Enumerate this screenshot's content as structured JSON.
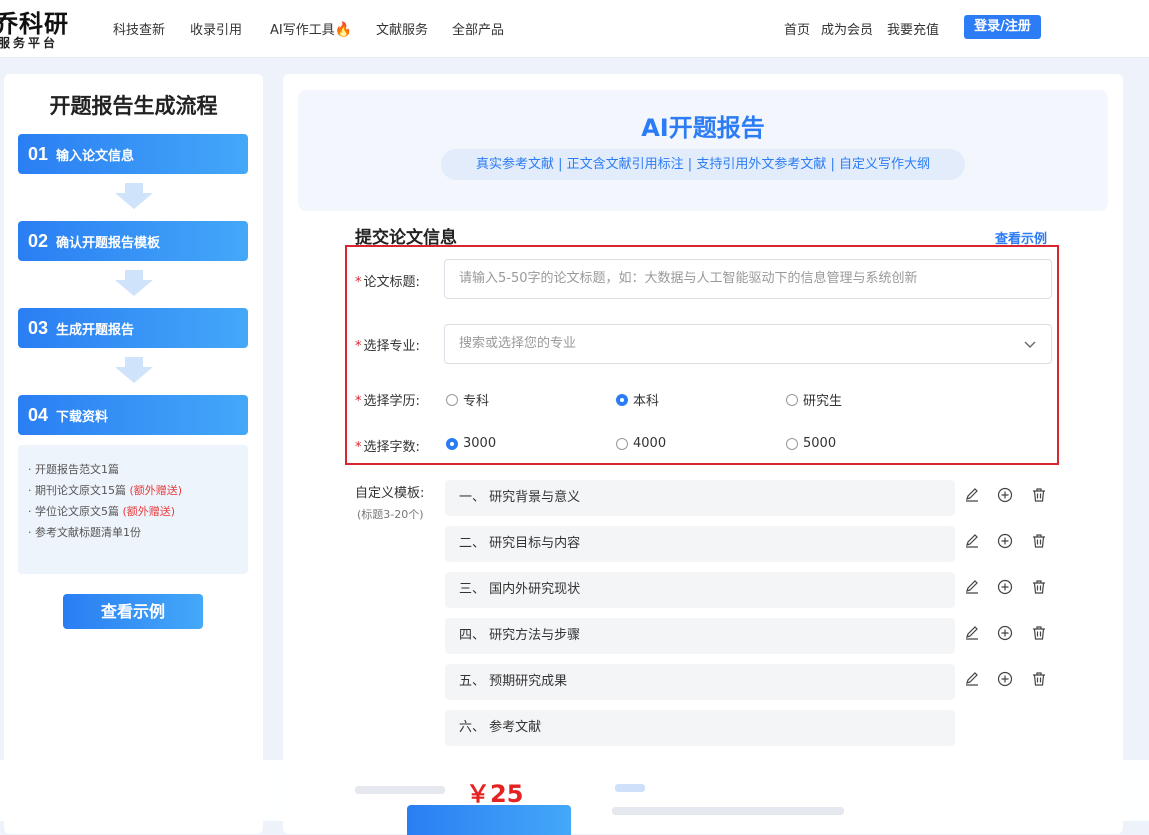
{
  "header": {
    "logo_main": "乔科研",
    "logo_sub": "服务平台",
    "nav": [
      "科技查新",
      "收录引用",
      "AI写作工具",
      "文献服务",
      "全部产品"
    ],
    "right_nav": [
      "首页",
      "成为会员",
      "我要充值"
    ],
    "login_label": "登录/注册",
    "fire_icon": "fire-icon"
  },
  "left": {
    "title": "开题报告生成流程",
    "steps": [
      {
        "num": "01",
        "label": "输入论文信息"
      },
      {
        "num": "02",
        "label": "确认开题报告模板"
      },
      {
        "num": "03",
        "label": "生成开题报告"
      },
      {
        "num": "04",
        "label": "下载资料"
      }
    ],
    "deliverables": [
      {
        "text": "· 开题报告范文1篇",
        "extra": ""
      },
      {
        "text": "· 期刊论文原文15篇",
        "extra": "(额外赠送)"
      },
      {
        "text": "· 学位论文原文5篇",
        "extra": "(额外赠送)"
      },
      {
        "text": "· 参考文献标题清单1份",
        "extra": ""
      }
    ],
    "example_button": "查看示例"
  },
  "main": {
    "hero_title": "AI开题报告",
    "hero_tags": "真实参考文献 | 正文含文献引用标注 | 支持引用外文参考文献 | 自定义写作大纲",
    "section_title": "提交论文信息",
    "view_example": "查看示例",
    "form": {
      "title_label": "论文标题:",
      "title_placeholder": "请输入5-50字的论文标题，如：大数据与人工智能驱动下的信息管理与系统创新",
      "major_label": "选择专业:",
      "major_placeholder": "搜索或选择您的专业",
      "degree_label": "选择学历:",
      "degree_options": [
        "专科",
        "本科",
        "研究生"
      ],
      "degree_selected": "本科",
      "words_label": "选择字数:",
      "words_options": [
        "3000",
        "4000",
        "5000"
      ],
      "words_selected": "3000",
      "required_mark": "*"
    },
    "template": {
      "label": "自定义模板:",
      "sub": "(标题3-20个)",
      "items": [
        "一、 研究背景与意义",
        "二、 研究目标与内容",
        "三、 国内外研究现状",
        "四、 研究方法与步骤",
        "五、 预期研究成果",
        "六、 参考文献"
      ],
      "icons": [
        "edit-icon",
        "add-circle-icon",
        "trash-icon"
      ]
    },
    "price": "￥25"
  }
}
